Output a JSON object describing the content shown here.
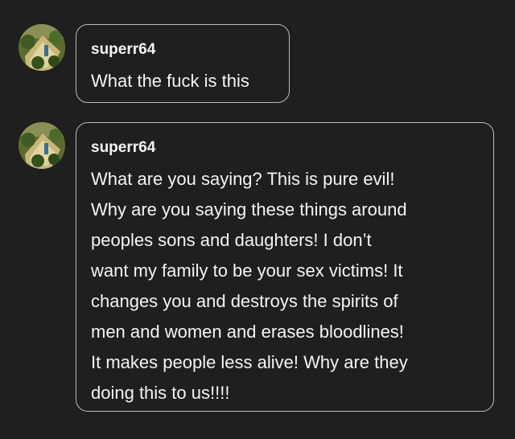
{
  "comments": [
    {
      "username": "superr64",
      "text": "What the fuck is this"
    },
    {
      "username": "superr64",
      "text": "What are you saying? This is pure evil!\nWhy are you saying these things around\npeoples sons and daughters! I don’t\nwant my family to be your sex victims! It\nchanges you and destroys the spirits of\nmen and women and erases bloodlines!\nIt makes people less alive! Why are they\ndoing this to us!!!!"
    }
  ]
}
